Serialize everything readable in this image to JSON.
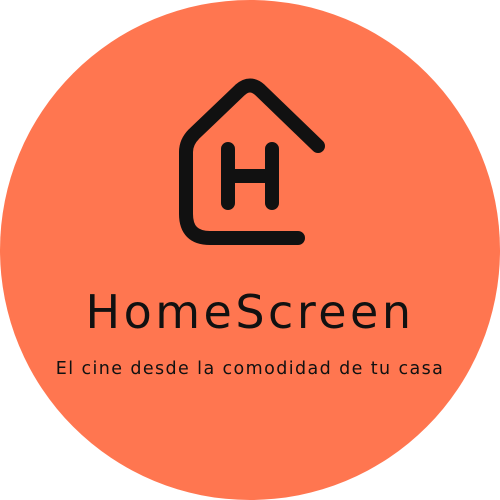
{
  "logo": {
    "icon": "house-h-icon",
    "brand_name": "HomeScreen",
    "tagline": "El cine desde la comodidad de tu casa"
  },
  "colors": {
    "circle": "#FF7650",
    "ink": "#111111",
    "background": "#FFFFFF"
  }
}
